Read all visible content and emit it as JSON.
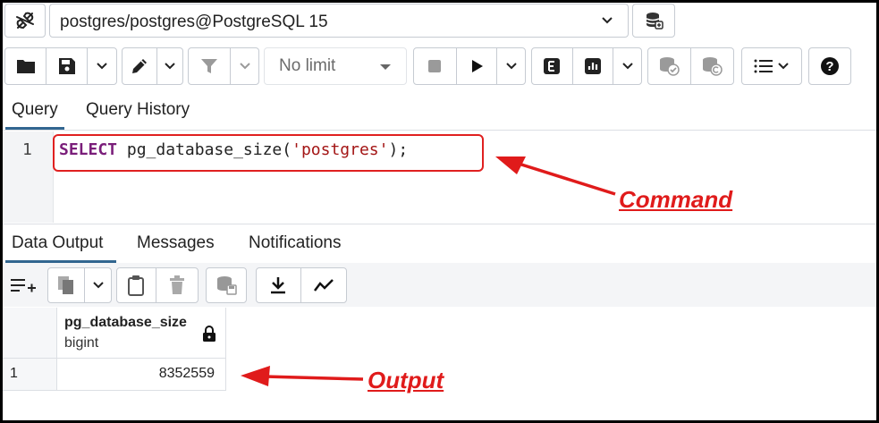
{
  "connection": {
    "label": "postgres/postgres@PostgreSQL 15",
    "icons": [
      "disconnect-plug-icon",
      "chevron-down-icon",
      "database-stack-icon"
    ]
  },
  "toolbar": {
    "limit_label": "No limit",
    "icons": [
      "folder-icon",
      "save-icon",
      "edit-pen-icon",
      "filter-icon",
      "stop-icon",
      "play-icon",
      "explain-e-icon",
      "explain-analyze-icon",
      "commit-icon",
      "rollback-icon",
      "macros-list-icon",
      "help-icon"
    ]
  },
  "editor_tabs": [
    {
      "label": "Query",
      "active": true
    },
    {
      "label": "Query History",
      "active": false
    }
  ],
  "editor": {
    "line_number": "1",
    "code": {
      "keyword": "SELECT",
      "fn_open": " pg_database_size(",
      "string": "'postgres'",
      "close": ");"
    }
  },
  "output_tabs": [
    {
      "label": "Data Output",
      "active": true
    },
    {
      "label": "Messages",
      "active": false
    },
    {
      "label": "Notifications",
      "active": false
    }
  ],
  "grid_toolbar": {
    "icons": [
      "add-row-icon",
      "copy-icon",
      "paste-icon",
      "delete-icon",
      "save-data-icon",
      "download-icon",
      "graph-icon"
    ]
  },
  "result": {
    "columns": [
      {
        "name": "pg_database_size",
        "type": "bigint"
      }
    ],
    "rows": [
      {
        "row_number": "1",
        "values": [
          "8352559"
        ]
      }
    ]
  },
  "annotations": {
    "command_label": "Command",
    "output_label": "Output",
    "color": "#e01b1b"
  },
  "colors": {
    "accent": "#326690",
    "keyword": "#7a1e7a",
    "string": "#a31515"
  }
}
